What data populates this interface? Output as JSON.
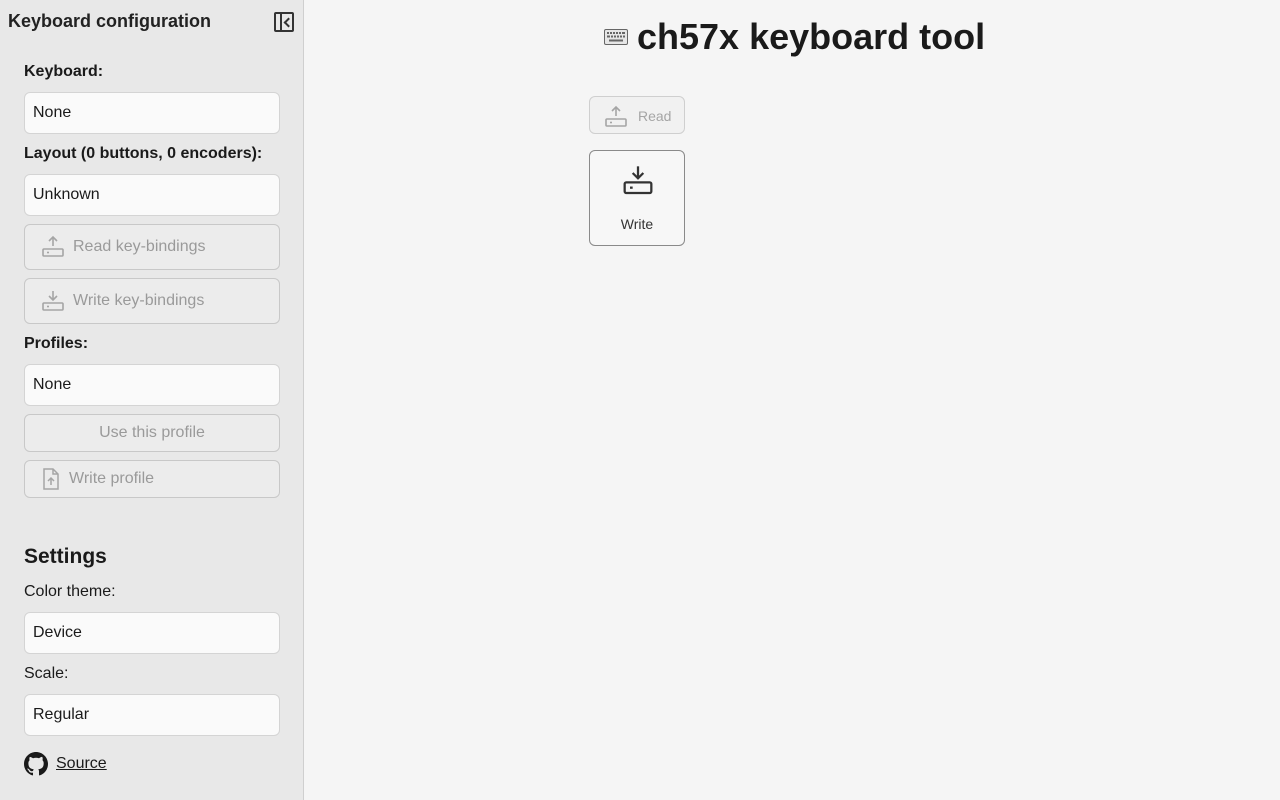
{
  "sidebar": {
    "title": "Keyboard configuration",
    "keyboard_label": "Keyboard:",
    "keyboard_value": "None",
    "layout_label": "Layout (0 buttons, 0 encoders):",
    "layout_value": "Unknown",
    "read_bindings": "Read key-bindings",
    "write_bindings": "Write key-bindings",
    "profiles_label": "Profiles:",
    "profiles_value": "None",
    "use_profile": "Use this profile",
    "write_profile": "Write profile",
    "settings_heading": "Settings",
    "color_theme_label": "Color theme:",
    "color_theme_value": "Device",
    "scale_label": "Scale:",
    "scale_value": "Regular",
    "source_link": "Source"
  },
  "main": {
    "title": "ch57x keyboard tool",
    "read_label": "Read",
    "write_label": "Write"
  },
  "icons": [
    "sidebar-collapse-icon",
    "upload-device-icon",
    "download-device-icon",
    "file-upload-icon",
    "github-icon",
    "keyboard-icon"
  ]
}
